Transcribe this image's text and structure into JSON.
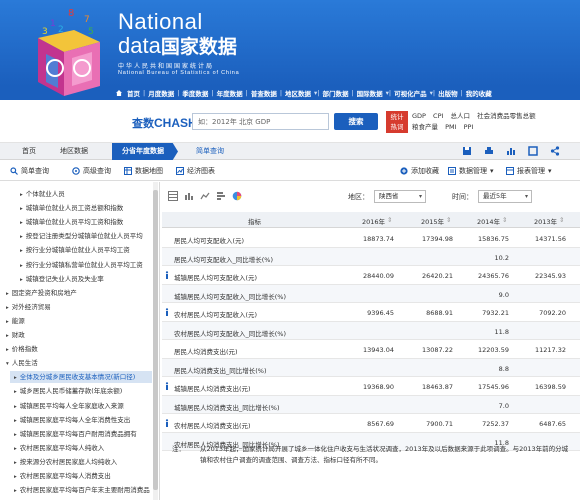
{
  "header": {
    "logo_national": "National",
    "logo_data": "data",
    "logo_cn": "国家数据",
    "logo_sub_cn": "中华人民共和国国家统计局",
    "logo_sub_en": "National Bureau of Statistics of China",
    "cube_digits": [
      "8",
      "7",
      "5",
      "1",
      "3",
      "2"
    ]
  },
  "nav": [
    "首页",
    "月度数据",
    "季度数据",
    "年度数据",
    "普查数据",
    "地区数据",
    "部门数据",
    "国际数据",
    "可视化产品",
    "出版物",
    "我的收藏"
  ],
  "search": {
    "brand_cn": "查数",
    "brand_en": "CHASHU",
    "placeholder": "如：2012年 北京 GDP",
    "button": "搜索",
    "hotword": [
      "统计",
      "热词"
    ],
    "hot_links_line1": [
      "GDP",
      "CPI",
      "总人口",
      "社会消费品零售总额"
    ],
    "hot_links_line2": [
      "粮食产量",
      "PMI",
      "PPI"
    ]
  },
  "tabs": {
    "home": "首页",
    "region": "地区数据",
    "active": "分省年度数据",
    "link": "简单查询"
  },
  "toolbar": {
    "simple_query": "简单查询",
    "advanced_query": "高级查询",
    "data_map": "数据地图",
    "economic_chart": "经济图表",
    "add_favorite": "添加收藏",
    "data_manage": "数据管理",
    "report_manage": "报表管理"
  },
  "sidebar": {
    "items": [
      {
        "label": "个体就业人员",
        "level": 3,
        "arrow": "▸"
      },
      {
        "label": "城镇单位就业人员工资总额和指数",
        "level": 3,
        "arrow": "▸"
      },
      {
        "label": "城镇单位就业人员平均工资和指数",
        "level": 3,
        "arrow": "▸"
      },
      {
        "label": "按登记注册类型分城镇单位就业人员平均",
        "level": 3,
        "arrow": "▸"
      },
      {
        "label": "按行业分城镇单位就业人员平均工资",
        "level": 3,
        "arrow": "▸"
      },
      {
        "label": "按行业分城镇私营单位就业人员平均工资",
        "level": 3,
        "arrow": "▸"
      },
      {
        "label": "城镇登记失业人员及失业率",
        "level": 3,
        "arrow": "▸"
      },
      {
        "label": "固定资产投资和房地产",
        "level": 1,
        "arrow": "▸"
      },
      {
        "label": "对外经济贸易",
        "level": 1,
        "arrow": "▸"
      },
      {
        "label": "能源",
        "level": 1,
        "arrow": "▸"
      },
      {
        "label": "财政",
        "level": 1,
        "arrow": "▸"
      },
      {
        "label": "价格指数",
        "level": 1,
        "arrow": "▸"
      },
      {
        "label": "人民生活",
        "level": 1,
        "arrow": "▾"
      },
      {
        "label": "全体及分城乡居民收支基本情况(新口径)",
        "level": 2,
        "arrow": "▸",
        "active": true
      },
      {
        "label": "城乡居民人民币储蓄存款(年底余额)",
        "level": 2,
        "arrow": "▸"
      },
      {
        "label": "城镇居民平均每人全年家庭收入来源",
        "level": 2,
        "arrow": "▸"
      },
      {
        "label": "城镇居民家庭平均每人全年消费性支出",
        "level": 2,
        "arrow": "▸"
      },
      {
        "label": "城镇居民家庭平均每百户耐用消费品拥有",
        "level": 2,
        "arrow": "▸"
      },
      {
        "label": "农村居民家庭平均每人纯收入",
        "level": 2,
        "arrow": "▸"
      },
      {
        "label": "按来源分农村居民家庭人均纯收入",
        "level": 2,
        "arrow": "▸"
      },
      {
        "label": "农村居民家庭平均每人消费支出",
        "level": 2,
        "arrow": "▸"
      },
      {
        "label": "农村居民家庭平均每百户年末主要耐用消费品",
        "level": 2,
        "arrow": "▸"
      }
    ]
  },
  "controls": {
    "region_label": "地区：",
    "region_value": "陕西省",
    "time_label": "时间：",
    "time_value": "最近5年"
  },
  "table": {
    "headers": [
      "指标",
      "2016年",
      "2015年",
      "2014年",
      "2013年"
    ],
    "rows": [
      {
        "label": "居民人均可支配收入(元)",
        "info": false,
        "values": [
          "18873.74",
          "17394.98",
          "15836.75",
          "14371.56"
        ]
      },
      {
        "label": "居民人均可支配收入_同比增长(%)",
        "info": false,
        "values": [
          "",
          "",
          "10.2",
          ""
        ]
      },
      {
        "label": "城镇居民人均可支配收入(元)",
        "info": true,
        "values": [
          "28440.09",
          "26420.21",
          "24365.76",
          "22345.93"
        ]
      },
      {
        "label": "城镇居民人均可支配收入_同比增长(%)",
        "info": false,
        "values": [
          "",
          "",
          "9.0",
          ""
        ]
      },
      {
        "label": "农村居民人均可支配收入(元)",
        "info": true,
        "values": [
          "9396.45",
          "8688.91",
          "7932.21",
          "7092.20"
        ]
      },
      {
        "label": "农村居民人均可支配收入_同比增长(%)",
        "info": false,
        "values": [
          "",
          "",
          "11.8",
          ""
        ]
      },
      {
        "label": "居民人均消费支出(元)",
        "info": false,
        "values": [
          "13943.04",
          "13087.22",
          "12203.59",
          "11217.32"
        ]
      },
      {
        "label": "居民人均消费支出_同比增长(%)",
        "info": false,
        "values": [
          "",
          "",
          "8.8",
          ""
        ]
      },
      {
        "label": "城镇居民人均消费支出(元)",
        "info": true,
        "values": [
          "19368.90",
          "18463.87",
          "17545.96",
          "16398.59"
        ]
      },
      {
        "label": "城镇居民人均消费支出_同比增长(%)",
        "info": false,
        "values": [
          "",
          "",
          "7.0",
          ""
        ]
      },
      {
        "label": "农村居民人均消费支出(元)",
        "info": true,
        "values": [
          "8567.69",
          "7900.71",
          "7252.37",
          "6487.65"
        ]
      },
      {
        "label": "农村居民人均消费支出_同比增长(%)",
        "info": false,
        "values": [
          "",
          "",
          "11.8",
          ""
        ]
      }
    ]
  },
  "note": {
    "label": "注：",
    "text": "从2013年起，国家统计局开展了城乡一体化住户收支与生活状况调查，2013年及以后数据来源于此项调查。与2013年前的分城镇和农村住户调查的调查范围、调查方法、指标口径有所不同。"
  },
  "colors": {
    "header_blue": "#1b5fbd",
    "hotword_red": "#d63b2e",
    "row_alt": "#f5f7fa"
  }
}
